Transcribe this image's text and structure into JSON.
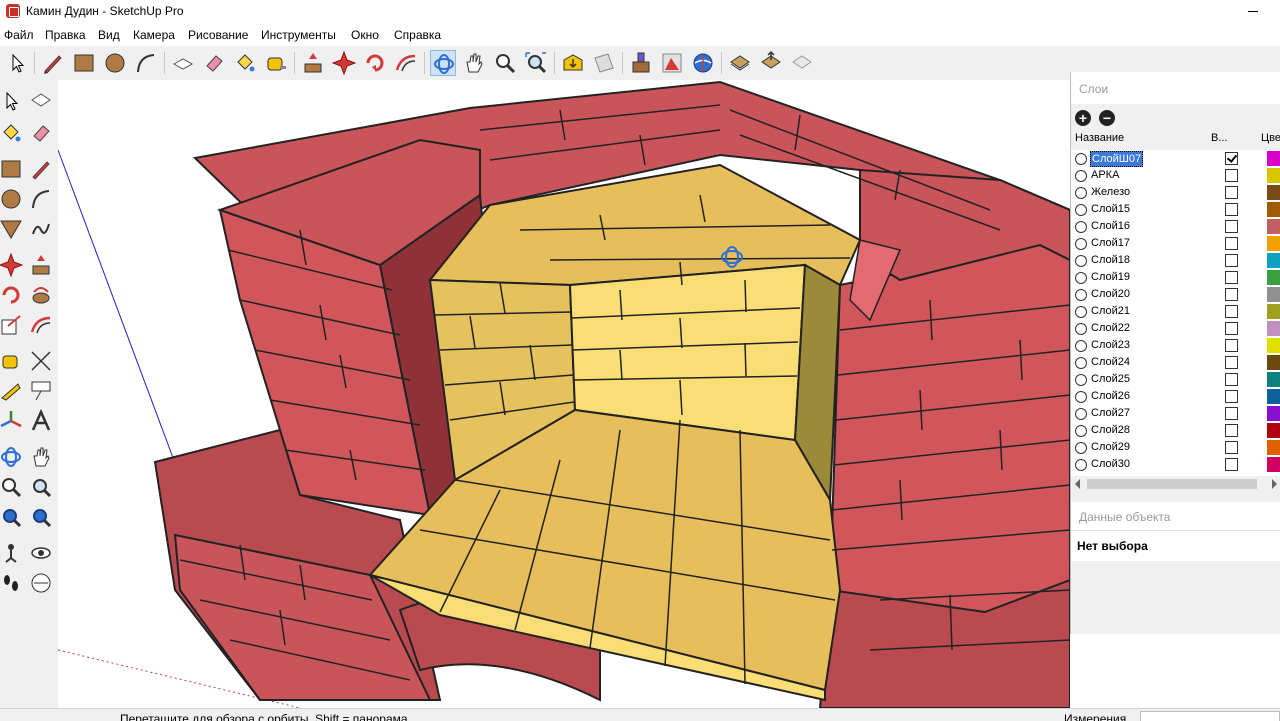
{
  "window": {
    "title": "Камин Дудин - SketchUp Pro",
    "brand_color": "#c8322b"
  },
  "menu": [
    "Файл",
    "Правка",
    "Вид",
    "Камера",
    "Рисование",
    "Инструменты",
    "Окно",
    "Справка"
  ],
  "toolbar": {
    "icons": [
      "select-icon",
      "pencil-icon",
      "rectangle-icon",
      "circle-icon",
      "arc-icon",
      "push-pull-icon",
      "eraser-icon",
      "paint-bucket-icon",
      "tape-measure-icon",
      "move-icon",
      "rotate-icon",
      "follow-me-icon",
      "offset-icon",
      "orbit-icon",
      "pan-icon",
      "zoom-icon",
      "zoom-extents-icon",
      "warehouse-icon",
      "extension-icon",
      "component-icon",
      "styles-icon",
      "geo-location-icon",
      "send-to-layout-icon",
      "share-model-icon",
      "get-models-icon"
    ],
    "active": "orbit-icon"
  },
  "left_toolbar": {
    "icons": [
      "select-icon",
      "make-component-icon",
      "paint-bucket-icon",
      "eraser-icon",
      "rectangle-icon",
      "line-icon",
      "circle-icon",
      "arc-icon",
      "polygon-icon",
      "freehand-icon",
      "move-icon",
      "push-pull-icon",
      "rotate-icon",
      "follow-me-icon",
      "scale-icon",
      "offset-icon",
      "tape-measure-icon",
      "dimension-icon",
      "protractor-icon",
      "text-icon",
      "axes-icon",
      "3d-text-icon",
      "orbit-icon",
      "pan-icon",
      "zoom-icon",
      "zoom-window-icon",
      "previous-view-icon",
      "next-view-icon",
      "position-camera-icon",
      "look-around-icon",
      "walk-icon",
      "section-plane-icon"
    ]
  },
  "viewport": {
    "model": "fireplace-brick-model",
    "brick_color": "#c9555a",
    "firebox_color": "#f3d36e"
  },
  "layers_panel": {
    "title": "Слои",
    "col_name": "Название",
    "col_visible": "В...",
    "col_color": "Цве",
    "add_button": "+",
    "remove_button": "−",
    "layers": [
      {
        "name": "СлойШ07",
        "visible": true,
        "selected": true,
        "color": "#d800c8"
      },
      {
        "name": "АРКА",
        "visible": false,
        "selected": false,
        "color": "#d7c600"
      },
      {
        "name": "Железо",
        "visible": false,
        "selected": false,
        "color": "#7a4a1a"
      },
      {
        "name": "Слой15",
        "visible": false,
        "selected": false,
        "color": "#a05a00"
      },
      {
        "name": "Слой16",
        "visible": false,
        "selected": false,
        "color": "#c06060"
      },
      {
        "name": "Слой17",
        "visible": false,
        "selected": false,
        "color": "#f0a000"
      },
      {
        "name": "Слой18",
        "visible": false,
        "selected": false,
        "color": "#10a0c0"
      },
      {
        "name": "Слой19",
        "visible": false,
        "selected": false,
        "color": "#3aa040"
      },
      {
        "name": "Слой20",
        "visible": false,
        "selected": false,
        "color": "#909090"
      },
      {
        "name": "Слой21",
        "visible": false,
        "selected": false,
        "color": "#a0a020"
      },
      {
        "name": "Слой22",
        "visible": false,
        "selected": false,
        "color": "#c090c0"
      },
      {
        "name": "Слой23",
        "visible": false,
        "selected": false,
        "color": "#e0e000"
      },
      {
        "name": "Слой24",
        "visible": false,
        "selected": false,
        "color": "#6a4a10"
      },
      {
        "name": "Слой25",
        "visible": false,
        "selected": false,
        "color": "#108080"
      },
      {
        "name": "Слой26",
        "visible": false,
        "selected": false,
        "color": "#1060a0"
      },
      {
        "name": "Слой27",
        "visible": false,
        "selected": false,
        "color": "#8a10d0"
      },
      {
        "name": "Слой28",
        "visible": false,
        "selected": false,
        "color": "#b00010"
      },
      {
        "name": "Слой29",
        "visible": false,
        "selected": false,
        "color": "#e06000"
      },
      {
        "name": "Слой30",
        "visible": false,
        "selected": false,
        "color": "#d00060"
      }
    ]
  },
  "object_panel": {
    "title": "Данные объекта",
    "selection": "Нет выбора"
  },
  "status": {
    "hint": "Перетащите для обзора с орбиты. Shift = панорама",
    "measure_label": "Измерения",
    "measure_value": ""
  }
}
